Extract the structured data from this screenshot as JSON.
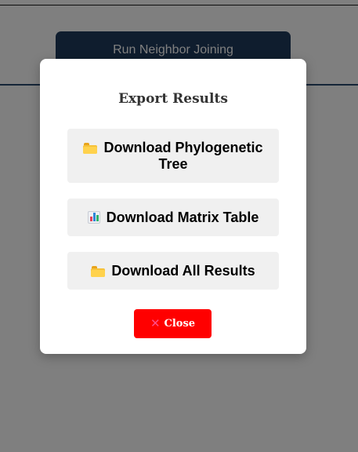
{
  "page": {
    "run_button_label": "Run Neighbor Joining"
  },
  "modal": {
    "title": "Export Results",
    "options": [
      {
        "label": "Download Phylogenetic Tree",
        "icon": "folder-icon"
      },
      {
        "label": "Download Matrix Table",
        "icon": "bar-chart-icon"
      },
      {
        "label": "Download All Results",
        "icon": "folder-icon"
      }
    ],
    "close_label": "Close",
    "close_icon": "close-icon"
  },
  "colors": {
    "overlay": "#808080",
    "run_button": "#1f3a5c",
    "close_button": "#ff0000",
    "option_background": "#f0f0f0"
  }
}
